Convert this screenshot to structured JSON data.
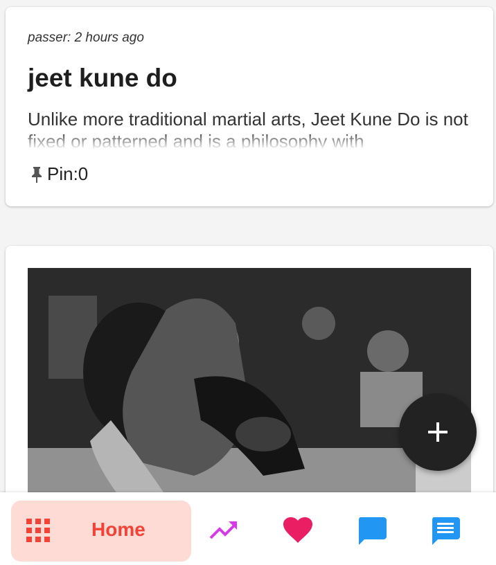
{
  "posts": [
    {
      "meta": "passer: 2 hours ago",
      "title": "jeet kune do",
      "body": "Unlike more traditional martial arts, Jeet Kune Do is not fixed or patterned and is a philosophy with",
      "pin_label": "Pin:0"
    },
    {
      "image_icon": "wrestling-photo"
    }
  ],
  "fab": {
    "icon": "plus-icon"
  },
  "bottom_nav": {
    "home_label": "Home",
    "items": [
      {
        "icon": "apps-grid-icon",
        "color": "#f44336"
      },
      {
        "icon": "trending-up-icon",
        "color": "#d63be8"
      },
      {
        "icon": "heart-icon",
        "color": "#e91e63"
      },
      {
        "icon": "chat-bubble-icon",
        "color": "#2196f3"
      },
      {
        "icon": "message-icon",
        "color": "#2196f3"
      }
    ]
  }
}
